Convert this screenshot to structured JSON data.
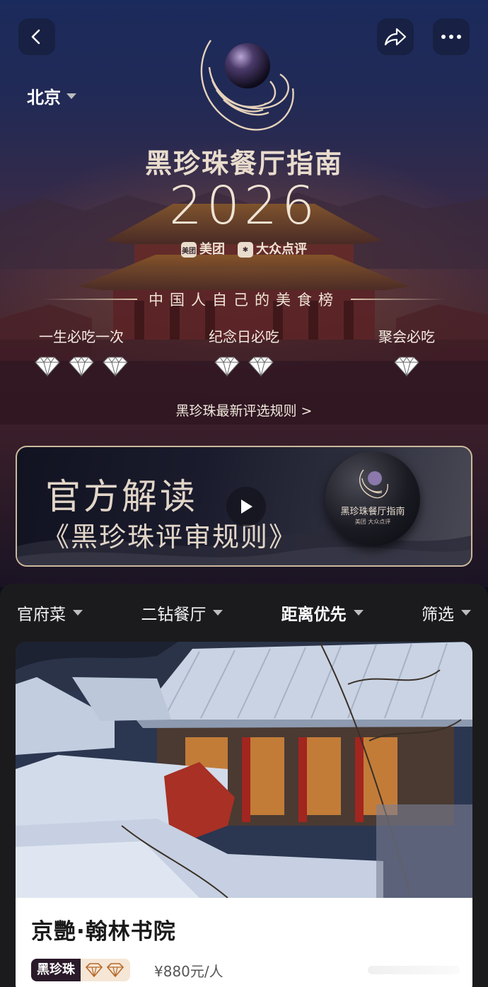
{
  "header": {
    "city": "北京",
    "back_icon": "chevron-left-icon",
    "share_icon": "share-icon",
    "more_icon": "more-dots-icon"
  },
  "brand": {
    "title": "黑珍珠餐厅指南",
    "year": "2026",
    "partner_1": "美团",
    "partner_1_badge": "美团",
    "partner_2": "大众点评",
    "slogan": "中国人自己的美食榜"
  },
  "tiers": [
    {
      "label": "一生必吃一次",
      "diamonds": 3
    },
    {
      "label": "纪念日必吃",
      "diamonds": 2
    },
    {
      "label": "聚会必吃",
      "diamonds": 1
    }
  ],
  "rules_link": "黑珍珠最新评选规则 >",
  "banner": {
    "line1": "官方解读",
    "line2": "《黑珍珠评审规则》",
    "orb_title": "黑珍珠餐厅指南",
    "orb_sub": "美团  大众点评"
  },
  "filters": [
    {
      "label": "官府菜",
      "active": false
    },
    {
      "label": "二钻餐厅",
      "active": false
    },
    {
      "label": "距离优先",
      "active": true
    },
    {
      "label": "筛选",
      "active": false
    }
  ],
  "restaurant": {
    "name": "京艷·翰林书院",
    "tag": "黑珍珠",
    "diamonds": 2,
    "price": "¥880元/人"
  },
  "colors": {
    "accent_gold": "#cdb89d",
    "diamond_fill": "#ffffff",
    "tag_bg": "#2a1a2a"
  }
}
